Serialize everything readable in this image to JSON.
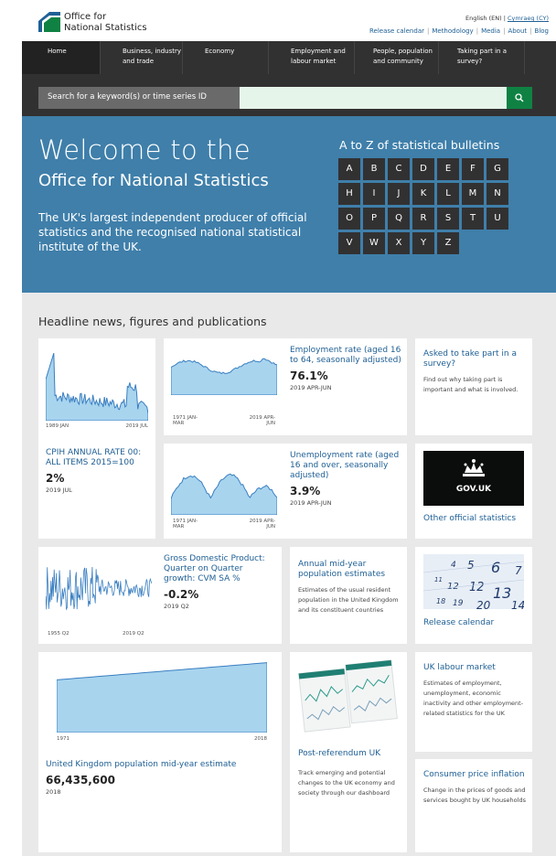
{
  "header": {
    "logo_line1": "Office for",
    "logo_line2": "National Statistics",
    "lang_current": "English (EN)",
    "lang_sep": "|",
    "lang_alt": "Cymraeg (CY)",
    "links": [
      "Release calendar",
      "Methodology",
      "Media",
      "About",
      "Blog"
    ]
  },
  "nav": {
    "items": [
      "Home",
      "Business, industry and trade",
      "Economy",
      "Employment and labour market",
      "People, population and community",
      "Taking part in a survey?"
    ]
  },
  "search": {
    "label": "Search for a keyword(s) or time series ID",
    "button_icon": "search-icon"
  },
  "hero": {
    "welcome": "Welcome to the",
    "org": "Office for National Statistics",
    "desc": "The UK's largest independent producer of official statistics and the recognised national statistical institute of the UK.",
    "az_title": "A to Z of statistical bulletins",
    "letters": [
      "A",
      "B",
      "C",
      "D",
      "E",
      "F",
      "G",
      "H",
      "I",
      "J",
      "K",
      "L",
      "M",
      "N",
      "O",
      "P",
      "Q",
      "R",
      "S",
      "T",
      "U",
      "V",
      "W",
      "X",
      "Y",
      "Z"
    ]
  },
  "headline": {
    "title": "Headline news, figures and publications"
  },
  "cards": {
    "cpih": {
      "title": "CPIH ANNUAL RATE 00: ALL ITEMS 2015=100",
      "value": "2%",
      "date": "2019 JUL",
      "x_start": "1989 JAN",
      "x_end": "2019 JUL"
    },
    "employment": {
      "title": "Employment rate (aged 16 to 64, seasonally adjusted)",
      "value": "76.1%",
      "date": "2019 APR-JUN",
      "x_start": "1971 JAN-MAR",
      "x_end": "2019 APR-JUN"
    },
    "unemployment": {
      "title": "Unemployment rate (aged 16 and over, seasonally adjusted)",
      "value": "3.9%",
      "date": "2019 APR-JUN",
      "x_start": "1971 JAN-MAR",
      "x_end": "2019 APR-JUN"
    },
    "survey": {
      "title": "Asked to take part in a survey?",
      "desc": "Find out why taking part is important and what is involved."
    },
    "govuk": {
      "logo_text": "GOV.UK",
      "link": "Other official statistics"
    },
    "gdp": {
      "title": "Gross Domestic Product: Quarter on Quarter growth: CVM SA %",
      "value": "-0.2%",
      "date": "2019 Q2",
      "x_start": "1955 Q2",
      "x_end": "2019 Q2"
    },
    "midyear": {
      "title": "Annual mid-year population estimates",
      "desc": "Estimates of the usual resident population in the United Kingdom and its constituent countries"
    },
    "release": {
      "title": "Release calendar"
    },
    "population": {
      "title": "United Kingdom population mid-year estimate",
      "value": "66,435,600",
      "date": "2018",
      "x_start": "1971",
      "x_end": "2018"
    },
    "postref": {
      "title": "Post-referendum UK",
      "desc": "Track emerging and potential changes to the UK economy and society through our dashboard"
    },
    "labour": {
      "title": "UK labour market",
      "desc": "Estimates of employment, unemployment, economic inactivity and other employment-related statistics for the UK"
    },
    "cpi": {
      "title": "Consumer price inflation",
      "desc": "Change in the prices of goods and services bought by UK households"
    }
  },
  "colors": {
    "accent": "#206095",
    "nav": "#323132",
    "hero": "#3f7faa",
    "search_btn": "#0f8243",
    "chart_fill": "#a8d4ee",
    "chart_line": "#3a7fc1"
  }
}
